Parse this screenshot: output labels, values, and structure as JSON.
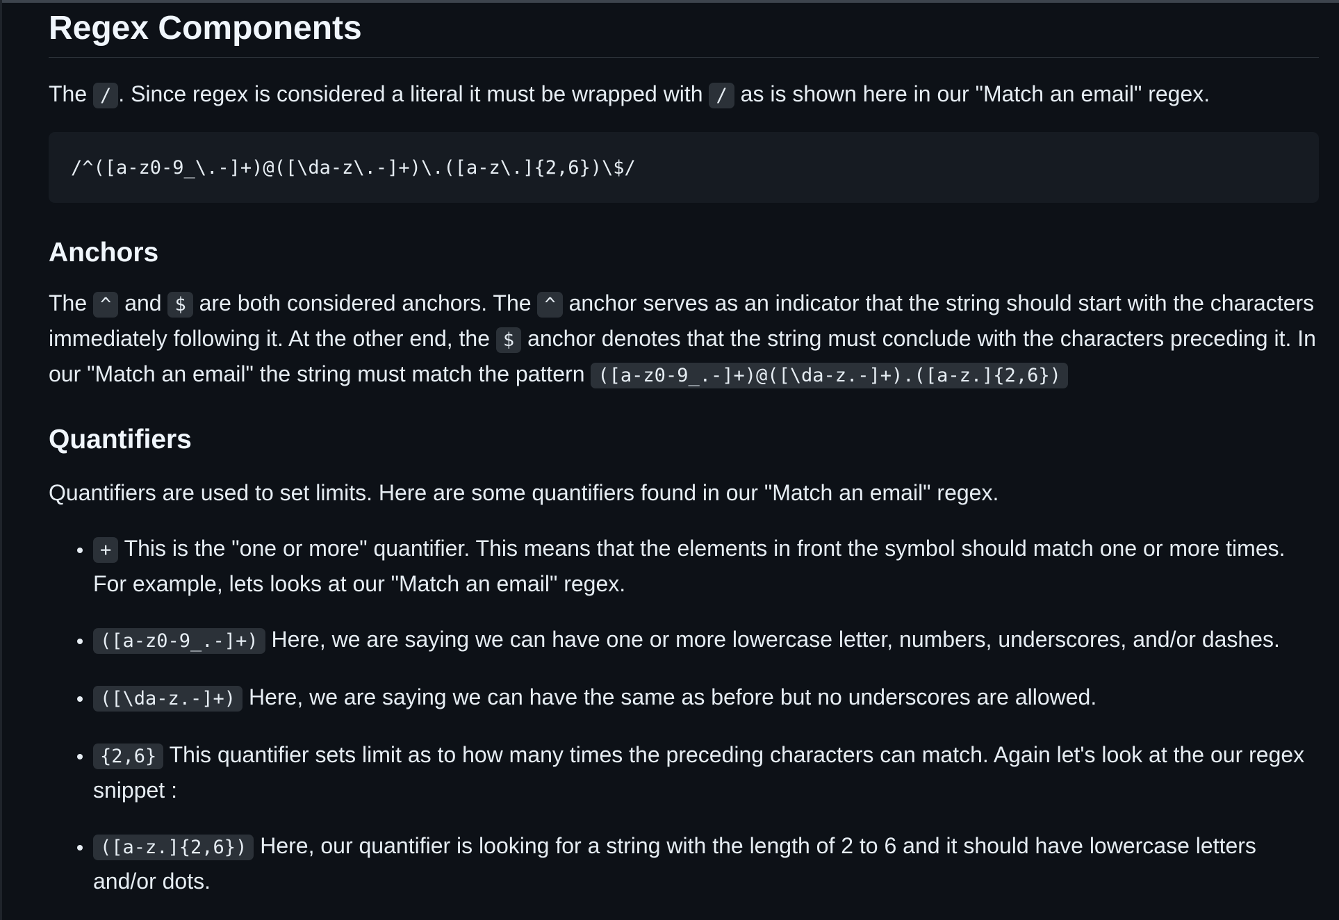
{
  "title": "Regex Components",
  "intro": {
    "t1": "The ",
    "c1": "/",
    "t2": ". Since regex is considered a literal it must be wrapped with ",
    "c2": "/",
    "t3": " as is shown here in our \"Match an email\" regex."
  },
  "code_block": "/^([a-z0-9_\\.-]+)@([\\da-z\\.-]+)\\.([a-z\\.]{2,6})\\$/",
  "anchors": {
    "heading": "Anchors",
    "t1": "The ",
    "c1": "^",
    "t2": " and ",
    "c2": "$",
    "t3": " are both considered anchors. The ",
    "c3": "^",
    "t4": " anchor serves as an indicator that the string should start with the characters immediately following it. At the other end, the ",
    "c4": "$",
    "t5": " anchor denotes that the string must conclude with the characters preceding it. In our \"Match an email\" the string must match the pattern ",
    "c5": "([a-z0-9_.-]+)@([\\da-z.-]+).([a-z.]{2,6})"
  },
  "quantifiers": {
    "heading": "Quantifiers",
    "intro": "Quantifiers are used to set limits. Here are some quantifiers found in our \"Match an email\" regex.",
    "items": [
      {
        "code": "+",
        "text": " This is the \"one or more\" quantifier. This means that the elements in front the symbol should match one or more times. For example, lets looks at our \"Match an email\" regex."
      },
      {
        "code": "([a-z0-9_.-]+)",
        "text": " Here, we are saying we can have one or more lowercase letter, numbers, underscores, and/or dashes."
      },
      {
        "code": "([\\da-z.-]+)",
        "text": " Here, we are saying we can have the same as before but no underscores are allowed."
      },
      {
        "code": "{2,6}",
        "text": " This quantifier sets limit as to how many times the preceding characters can match. Again let's look at the our regex snippet :"
      },
      {
        "code": "([a-z.]{2,6})",
        "text": " Here, our quantifier is looking for a string with the length of 2 to 6 and it should have lowercase letters and/or dots."
      }
    ]
  }
}
